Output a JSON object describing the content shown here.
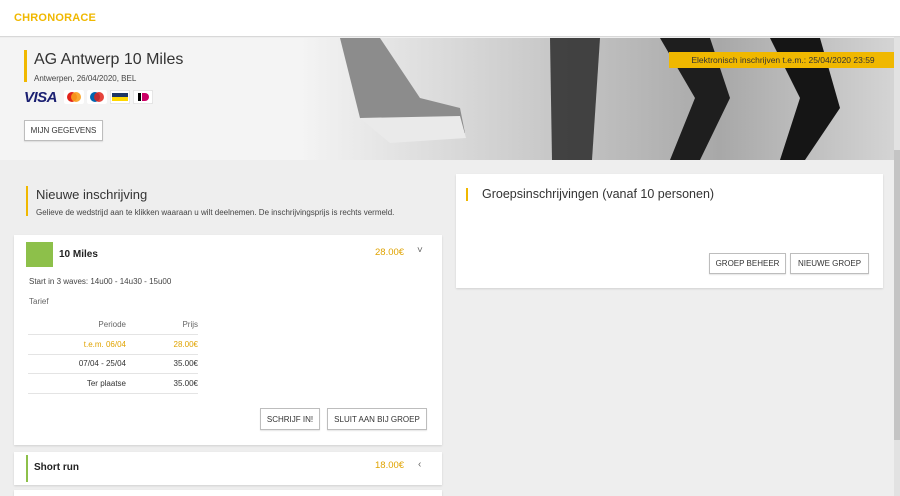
{
  "header": {
    "brand": "CHRONORACE"
  },
  "event": {
    "title": "AG Antwerp 10 Miles",
    "subtitle": "Antwerpen, 26/04/2020, BEL",
    "payment_methods": [
      "VISA",
      "maestro",
      "mastercard",
      "bancontact",
      "ideal"
    ],
    "deadline": "Elektronisch inschrijven t.e.m.: 25/04/2020 23:59",
    "my_data_button": "MIJN GEGEVENS"
  },
  "new_registration": {
    "title": "Nieuwe inschrijving",
    "subtitle": "Gelieve de wedstrijd aan te klikken waaraan u wilt deelnemen. De inschrijvingsprijs is rechts vermeld."
  },
  "races": [
    {
      "name": "10 Miles",
      "price": "28.00€",
      "start_info": "Start in 3 waves: 14u00 - 14u30 - 15u00",
      "tarief_label": "Tarief",
      "table_headers": {
        "period": "Periode",
        "price": "Prijs"
      },
      "rows": [
        {
          "period": "t.e.m. 06/04",
          "price": "28.00€",
          "highlighted": true
        },
        {
          "period": "07/04 - 25/04",
          "price": "35.00€",
          "highlighted": false
        },
        {
          "period": "Ter plaatse",
          "price": "35.00€",
          "highlighted": false
        }
      ],
      "register_button": "SCHRIJF IN!",
      "join_group_button": "SLUIT AAN BIJ GROEP"
    },
    {
      "name": "Short run",
      "price": "18.00€"
    }
  ],
  "group": {
    "title": "Groepsinschrijvingen (vanaf 10 personen)",
    "manage_button": "GROEP BEHEER",
    "new_button": "NIEUWE GROEP"
  },
  "colors": {
    "accent": "#f0b800",
    "race_green": "#8dc04a",
    "price": "#e0a300"
  }
}
